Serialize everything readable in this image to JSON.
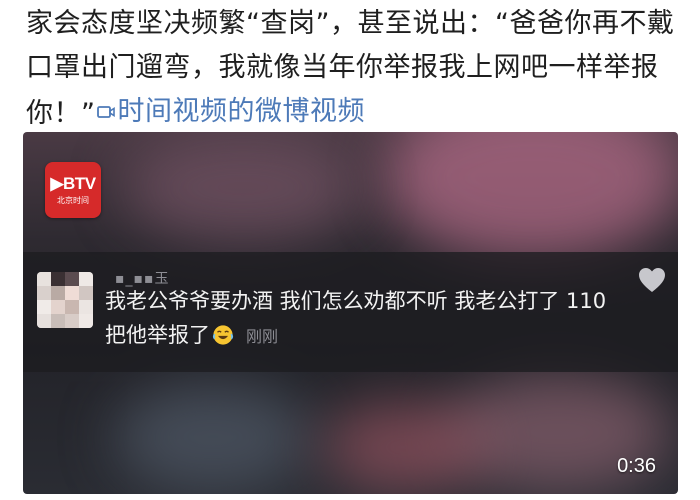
{
  "post": {
    "text": "家会态度坚决频繁“查岗”，甚至说出：“爸爸你再不戴口罩出门遛弯，我就像当年你举报我上网吧一样举报你！”",
    "video_link_label": "时间视频的微博视频",
    "link_color": "#4d7ab8"
  },
  "video": {
    "channel_logo": {
      "main": "▶BTV",
      "sub": "北京时间",
      "color": "#d62a2a"
    },
    "comment": {
      "username": "▪_▪▪玉",
      "text": "我老公爷爷要办酒 我们怎么劝都不听 我老公打了 110 把他举报了",
      "emoji": "laughing-crying-emoji",
      "time": "刚刚"
    },
    "like_icon": "heart-icon",
    "duration": "0:36"
  }
}
